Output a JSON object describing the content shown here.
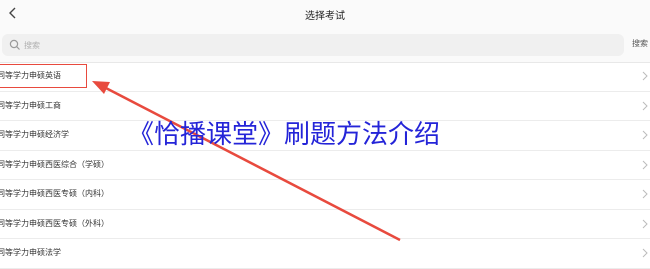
{
  "header": {
    "title": "选择考试",
    "back_icon": "chevron-left-icon"
  },
  "search": {
    "placeholder": "搜索",
    "button_label": "搜索",
    "icon": "search-icon"
  },
  "list": {
    "items": [
      {
        "label": "同等学力申硕英语"
      },
      {
        "label": "同等学力申硕工商"
      },
      {
        "label": "同等学力申硕经济学"
      },
      {
        "label": "同等学力申硕西医综合（学硕）"
      },
      {
        "label": "同等学力申硕西医专硕（内科）"
      },
      {
        "label": "同等学力申硕西医专硕（外科）"
      },
      {
        "label": "同等学力申硕法学"
      }
    ],
    "row_icon": "chevron-right-icon"
  },
  "overlay": {
    "title": "《恰播课堂》刷题方法介绍",
    "title_color": "#2424d8",
    "annotation_color": "#e84a3e"
  }
}
